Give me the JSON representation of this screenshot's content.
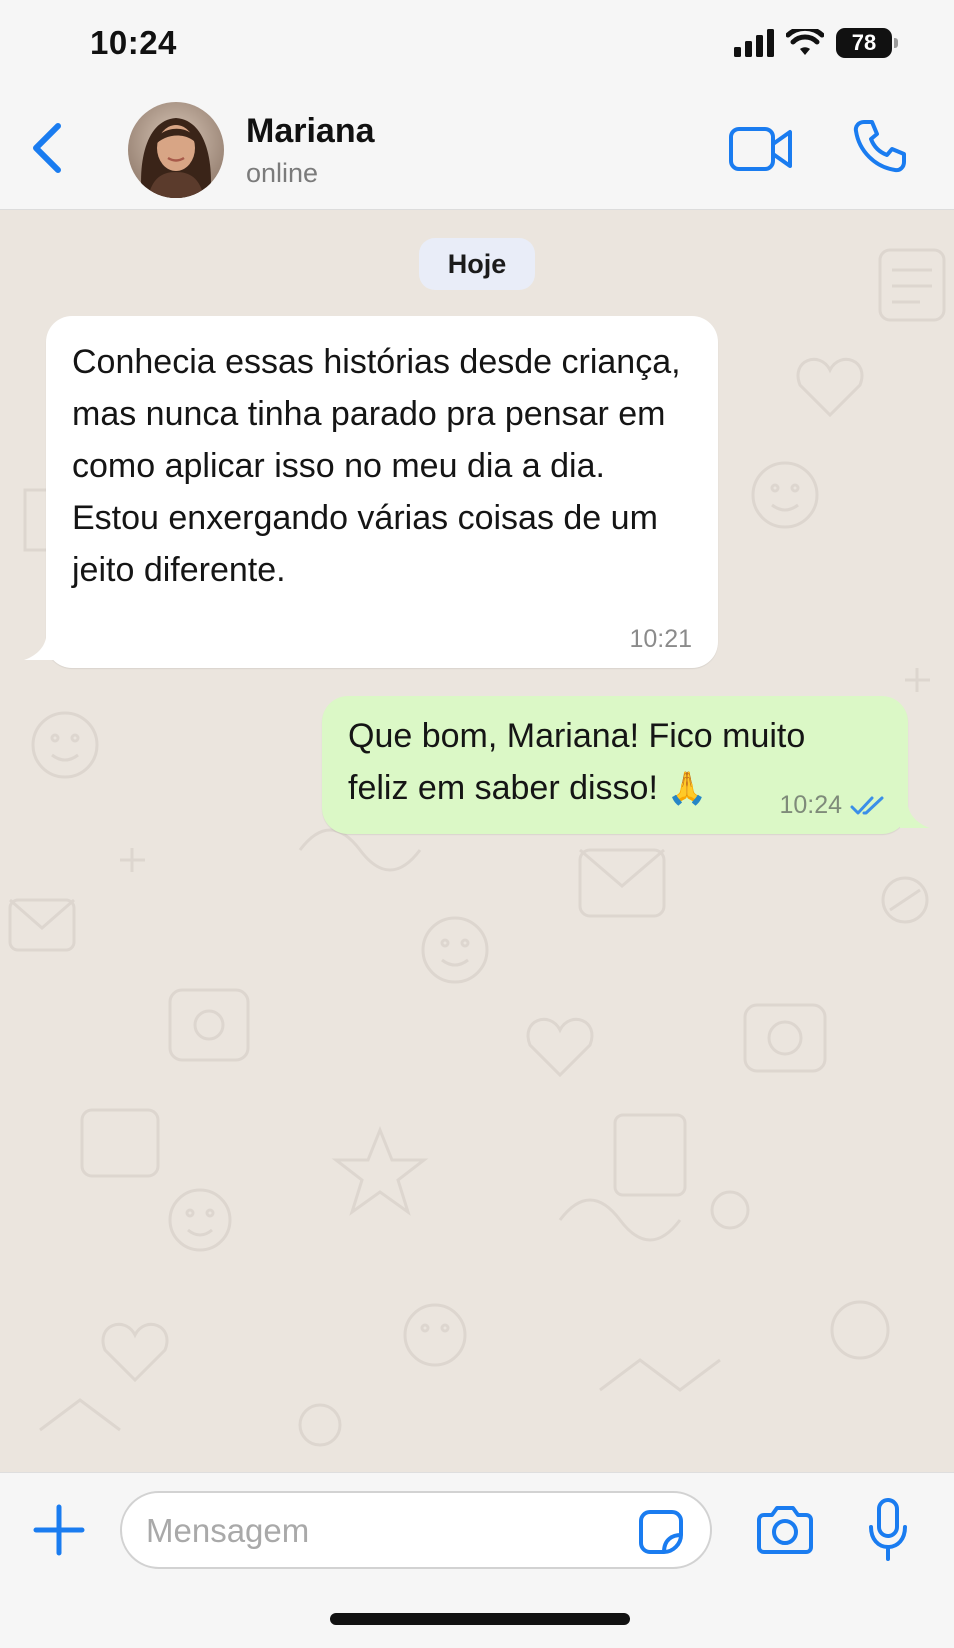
{
  "status_bar": {
    "time": "10:24",
    "battery": "78",
    "icons": [
      "cellular-signal-icon",
      "wifi-icon",
      "battery-icon"
    ]
  },
  "header": {
    "contact_name": "Mariana",
    "contact_status": "online",
    "icons": [
      "back-chevron-icon",
      "video-call-icon",
      "phone-call-icon"
    ]
  },
  "chat": {
    "date_label": "Hoje",
    "messages": [
      {
        "direction": "incoming",
        "text": "Conhecia essas histórias desde criança, mas nunca tinha parado pra pensar em como aplicar isso no meu dia a dia. Estou enxergando várias coisas de um jeito diferente.",
        "time": "10:21"
      },
      {
        "direction": "outgoing",
        "text": "Que bom, Mariana! Fico muito feliz em saber disso!",
        "emoji": "🙏",
        "time": "10:24",
        "read_status": "double-check-read"
      }
    ]
  },
  "composer": {
    "placeholder": "Mensagem",
    "value": "",
    "icons": [
      "plus-icon",
      "sticker-icon",
      "camera-icon",
      "microphone-icon"
    ]
  },
  "colors": {
    "accent": "#1a7cf0",
    "incoming_bubble": "#ffffff",
    "outgoing_bubble": "#dbf8c6",
    "chat_background": "#ebe5de",
    "read_check": "#3b8fe8"
  }
}
